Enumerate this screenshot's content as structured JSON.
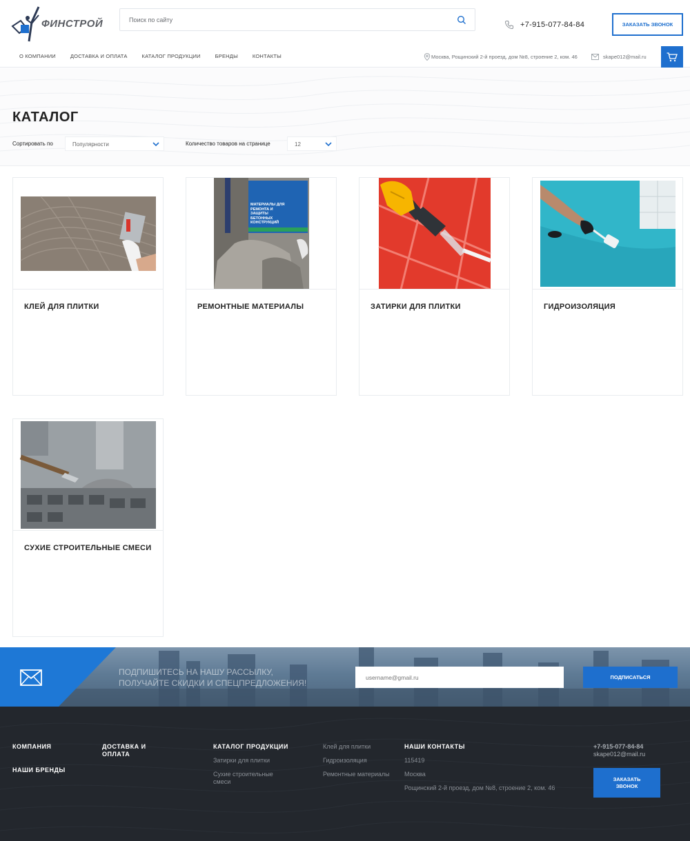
{
  "header": {
    "logo_text": "ФИНСТРОЙ",
    "search_placeholder": "Поиск по сайту",
    "phone": "+7-915-077-84-84",
    "callback_label": "ЗАКАЗАТЬ ЗВОНОК",
    "nav": [
      "О КОМПАНИИ",
      "ДОСТАВКА И ОПЛАТА",
      "КАТАЛОГ ПРОДУКЦИИ",
      "БРЕНДЫ",
      "КОНТАКТЫ"
    ],
    "address": "Москва, Рощинский 2-й проезд, дом №8, строение 2, ком. 46",
    "email": "skape012@mail.ru"
  },
  "catalog": {
    "title": "КАТАЛОГ",
    "sort_label": "Сортировать по",
    "sort_value": "Популярности",
    "count_label": "Количество товаров на странице",
    "count_value": "12",
    "items": [
      {
        "title": "КЛЕЙ ДЛЯ ПЛИТКИ"
      },
      {
        "title": "РЕМОНТНЫЕ МАТЕРИАЛЫ",
        "image_text": "МАТЕРИАЛЫ ДЛЯ РЕМОНТА И ЗАЩИТЫ БЕТОННЫХ КОНСТРУКЦИЙ"
      },
      {
        "title": "ЗАТИРКИ ДЛЯ ПЛИТКИ"
      },
      {
        "title": "ГИДРОИЗОЛЯЦИЯ"
      },
      {
        "title": "СУХИЕ СТРОИТЕЛЬНЫЕ СМЕСИ"
      }
    ]
  },
  "subscribe": {
    "text_line1": "ПОДПИШИТЕСЬ НА НАШУ РАССЫЛКУ,",
    "text_line2": "ПОЛУЧАЙТЕ СКИДКИ И СПЕЦПРЕДЛОЖЕНИЯ!",
    "email_placeholder": "username@gmail.ru",
    "button_label": "ПОДПИСАТЬСЯ"
  },
  "footer": {
    "company": "КОМПАНИЯ",
    "brands": "НАШИ БРЕНДЫ",
    "delivery": "ДОСТАВКА И ОПЛАТА",
    "catalog_head": "КАТАЛОГ ПРОДУКЦИИ",
    "catalog_links": [
      "Затирки для плитки",
      "Сухие строительные смеси",
      "Клей для плитки",
      "Гидроизоляция",
      "Ремонтные материалы"
    ],
    "contacts_head": "НАШИ КОНТАКТЫ",
    "postcode": "115419",
    "city": "Москва",
    "street": "Рощинский 2-й проезд, дом №8, строение 2, ком. 46",
    "phone": "+7-915-077-84-84",
    "email": "skape012@mail.ru",
    "callback_label": "ЗАКАЗАТЬ ЗВОНОК"
  },
  "colors": {
    "accent": "#1e6fce",
    "footer_bg": "#23272d"
  }
}
